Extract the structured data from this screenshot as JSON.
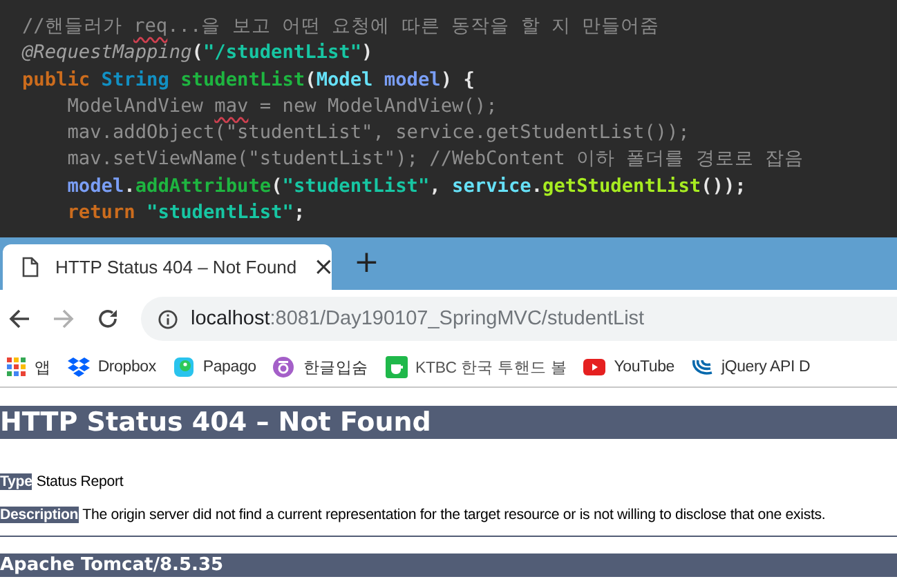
{
  "editor": {
    "lines": [
      [
        {
          "text": "//핸들러가 ",
          "kind": "comment"
        },
        {
          "text": "req",
          "kind": "comment-misspelled"
        },
        {
          "text": "...을 보고 어떤 요청에 따른 동작을 할 지 만들어줌",
          "kind": "comment"
        }
      ],
      [
        {
          "text": "@RequestMapping",
          "kind": "annotation"
        },
        {
          "text": "(",
          "kind": "plain"
        },
        {
          "text": "\"/studentList\"",
          "kind": "string"
        },
        {
          "text": ")",
          "kind": "plain"
        }
      ],
      [
        {
          "text": "public ",
          "kind": "keyword"
        },
        {
          "text": "String ",
          "kind": "type"
        },
        {
          "text": "studentList",
          "kind": "method"
        },
        {
          "text": "(",
          "kind": "plain"
        },
        {
          "text": "Model ",
          "kind": "class"
        },
        {
          "text": "model",
          "kind": "param"
        },
        {
          "text": ") {",
          "kind": "plain"
        }
      ],
      [
        {
          "text": "    ModelAndView ",
          "kind": "dim"
        },
        {
          "text": "mav",
          "kind": "dim-misspelled"
        },
        {
          "text": " = new ModelAndView();",
          "kind": "dim"
        }
      ],
      [
        {
          "text": "    mav.addObject(\"studentList\", service.getStudentList());",
          "kind": "dim"
        }
      ],
      [
        {
          "text": "    mav.setViewName(\"studentList\"); //WebContent ",
          "kind": "dim"
        },
        {
          "text": "이하 폴더를 경로로 잡음",
          "kind": "dim"
        }
      ],
      [
        {
          "text": "    model",
          "kind": "param"
        },
        {
          "text": ".",
          "kind": "plain"
        },
        {
          "text": "addAttribute",
          "kind": "method"
        },
        {
          "text": "(",
          "kind": "plain"
        },
        {
          "text": "\"studentList\"",
          "kind": "string"
        },
        {
          "text": ", ",
          "kind": "plain"
        },
        {
          "text": "service",
          "kind": "field"
        },
        {
          "text": ".",
          "kind": "plain"
        },
        {
          "text": "getStudentList",
          "kind": "call"
        },
        {
          "text": "());",
          "kind": "plain"
        }
      ],
      [
        {
          "text": "    return ",
          "kind": "keyword"
        },
        {
          "text": "\"studentList\"",
          "kind": "string"
        },
        {
          "text": ";",
          "kind": "plain"
        }
      ]
    ]
  },
  "browser": {
    "tab": {
      "title": "HTTP Status 404 – Not Found",
      "close": "×",
      "selected": true
    },
    "new_tab": "+",
    "nav": [
      {
        "kind": "back",
        "disabled": false
      },
      {
        "kind": "forward",
        "disabled": true
      },
      {
        "kind": "reload",
        "disabled": false
      }
    ],
    "address": {
      "host": "localhost",
      "path": ":8081/Day190107_SpringMVC/studentList"
    },
    "bookmarks": [
      {
        "kind": "apps",
        "label": "앱"
      },
      {
        "kind": "dropbox",
        "label": "Dropbox"
      },
      {
        "kind": "papago",
        "label": "Papago"
      },
      {
        "kind": "circle",
        "label": "한글입숨"
      },
      {
        "kind": "cup",
        "label": "KTBC 한국 투핸드 볼"
      },
      {
        "kind": "youtube",
        "label": "YouTube"
      },
      {
        "kind": "jquery",
        "label": "jQuery API D"
      }
    ]
  },
  "page": {
    "heading": "HTTP Status 404 – Not Found",
    "fields": [
      {
        "label": "Type",
        "value": "Status Report"
      },
      {
        "label": "Description",
        "value": "The origin server did not find a current representation for the target resource or is not willing to disclose that one exists."
      }
    ],
    "footer": "Apache Tomcat/8.5.35"
  }
}
